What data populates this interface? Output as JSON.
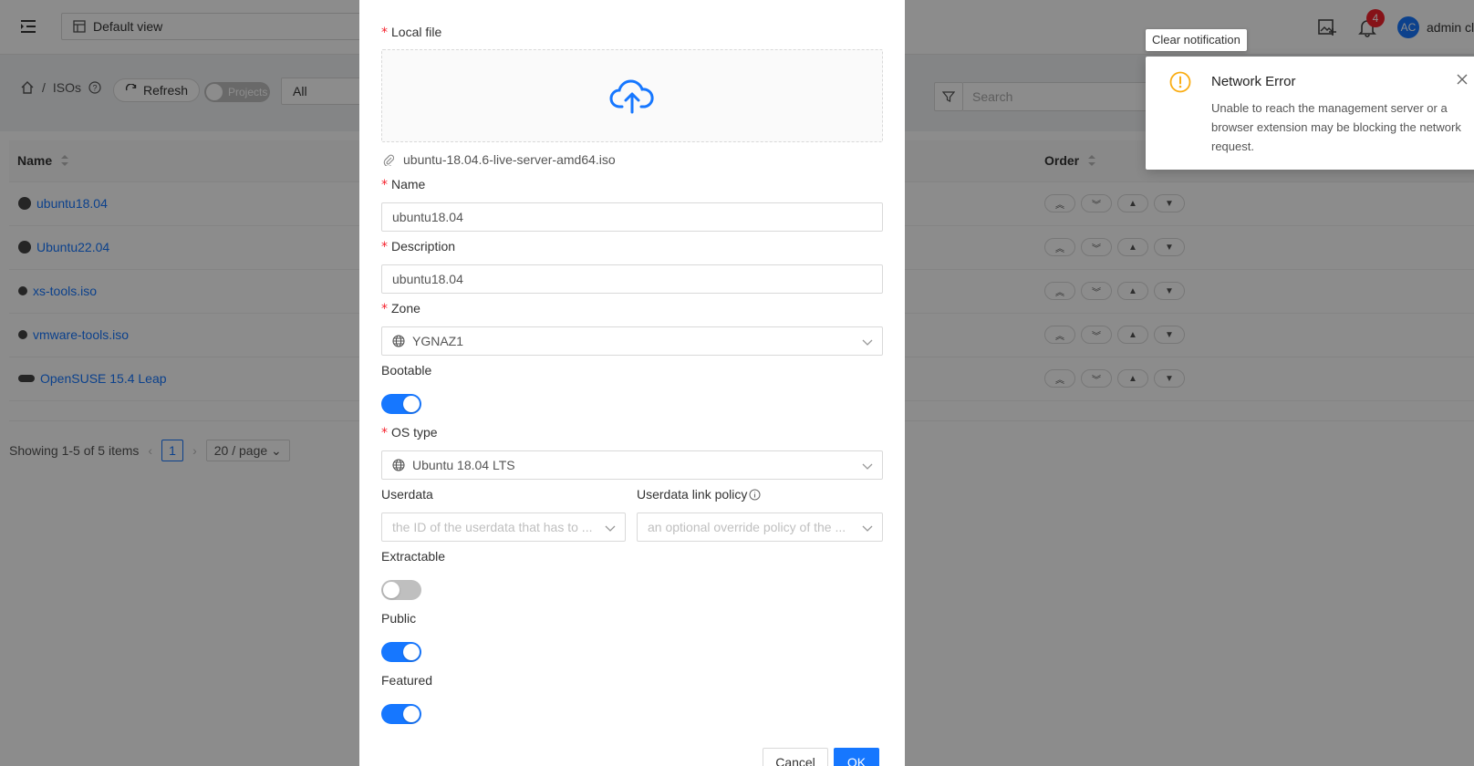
{
  "header": {
    "view_select": "Default view",
    "notification_count": "4",
    "avatar_initials": "AC",
    "user_name": "admin cl"
  },
  "toolbar": {
    "breadcrumb_section": "ISOs",
    "refresh_label": "Refresh",
    "projects_toggle_label": "Projects",
    "filter_value": "All",
    "search_placeholder": "Search"
  },
  "table": {
    "columns": {
      "name": "Name",
      "order": "Order"
    },
    "rows": [
      {
        "name": "ubuntu18.04"
      },
      {
        "name": "Ubuntu22.04"
      },
      {
        "name": "xs-tools.iso"
      },
      {
        "name": "vmware-tools.iso"
      },
      {
        "name": "OpenSUSE 15.4 Leap"
      }
    ]
  },
  "pagination": {
    "summary": "Showing 1-5 of 5 items",
    "current_page": "1",
    "page_size": "20 / page"
  },
  "modal": {
    "local_file_label": "Local file",
    "file_name": "ubuntu-18.04.6-live-server-amd64.iso",
    "name_label": "Name",
    "name_value": "ubuntu18.04",
    "description_label": "Description",
    "description_value": "ubuntu18.04",
    "zone_label": "Zone",
    "zone_value": "YGNAZ1",
    "bootable_label": "Bootable",
    "bootable": true,
    "os_type_label": "OS type",
    "os_type_value": "Ubuntu 18.04 LTS",
    "userdata_label": "Userdata",
    "userdata_placeholder": "the ID of the userdata that has to ...",
    "userdata_link_policy_label": "Userdata link policy",
    "userdata_link_policy_placeholder": "an optional override policy of the ...",
    "extractable_label": "Extractable",
    "extractable": false,
    "public_label": "Public",
    "public": true,
    "featured_label": "Featured",
    "featured": true,
    "cancel_label": "Cancel",
    "ok_label": "OK"
  },
  "notification": {
    "clear_label": "Clear notification",
    "title": "Network Error",
    "description": "Unable to reach the management server or a browser extension may be blocking the network request.",
    "icon": "warning-circle-icon",
    "color": "#faad14"
  },
  "colors": {
    "primary": "#1677ff",
    "required": "#f5222d",
    "mask": "rgba(0,0,0,0.45)"
  }
}
